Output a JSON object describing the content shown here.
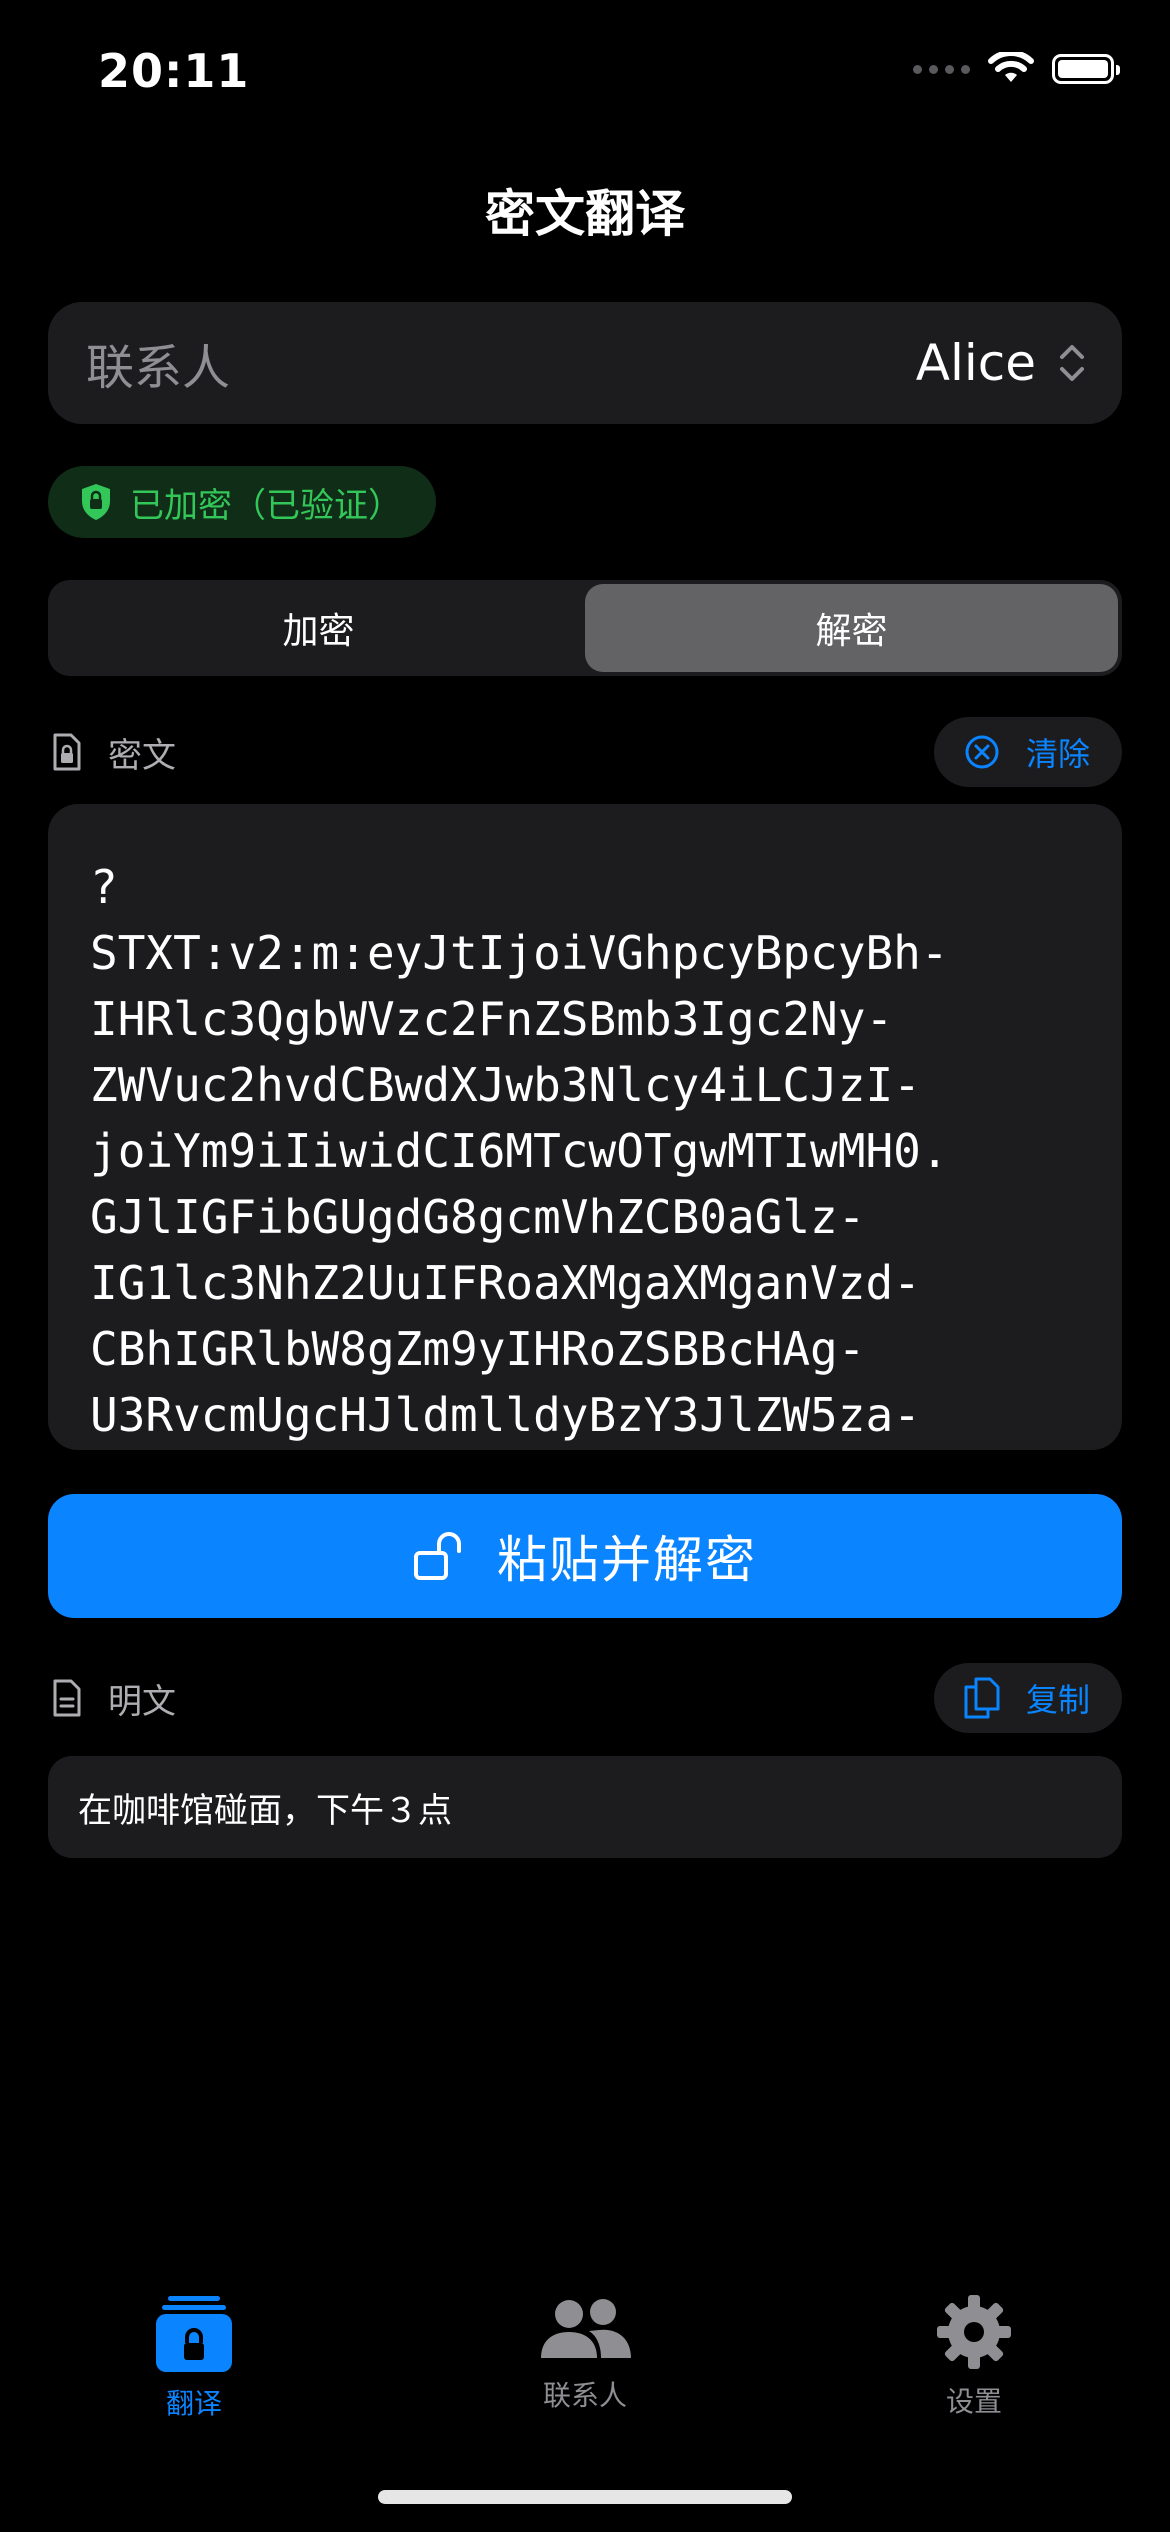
{
  "status_bar": {
    "time": "20:11"
  },
  "nav": {
    "title": "密文翻译"
  },
  "contact": {
    "label": "联系人",
    "value": "Alice"
  },
  "badge": {
    "text": "已加密（已验证）"
  },
  "mode_segment": {
    "options": [
      "加密",
      "解密"
    ],
    "selected": "解密"
  },
  "ciphertext_section": {
    "label": "密文",
    "clear_label": "清除",
    "content": "?\nSTXT:v2:m:eyJtIjoiVGhpcyBpcyBh-\nIHRlc3QgbWVzc2FnZSBmb3Igc2Ny-\nZWVuc2hvdCBwdXJwb3Nlcy4iLCJzI-\njoiYm9iIiwidCI6MTcwOTgwMTIwMH0.\nGJlIGFibGUgdG8gcmVhZCB0aGlz-\nIG1lc3NhZ2UuIFRoaXMgaXMganVzd-\nCBhIGRlbW8gZm9yIHRoZSBBcHAg-\nU3RvcmUgcHJldmlldyBzY3JlZW5za-"
  },
  "primary_action": {
    "label": "粘贴并解密"
  },
  "plaintext_section": {
    "label": "明文",
    "copy_label": "复制",
    "content": "在咖啡馆碰面，下午３点"
  },
  "tab_bar": {
    "items": [
      {
        "label": "翻译",
        "icon": "lock-stack-icon",
        "active": true
      },
      {
        "label": "联系人",
        "icon": "people-icon",
        "active": false
      },
      {
        "label": "设置",
        "icon": "gear-icon",
        "active": false
      }
    ]
  },
  "colors": {
    "accent": "#0a84ff",
    "success": "#33c759",
    "background": "#000000",
    "card": "#1c1c1e",
    "inactive": "#8e8e93"
  }
}
